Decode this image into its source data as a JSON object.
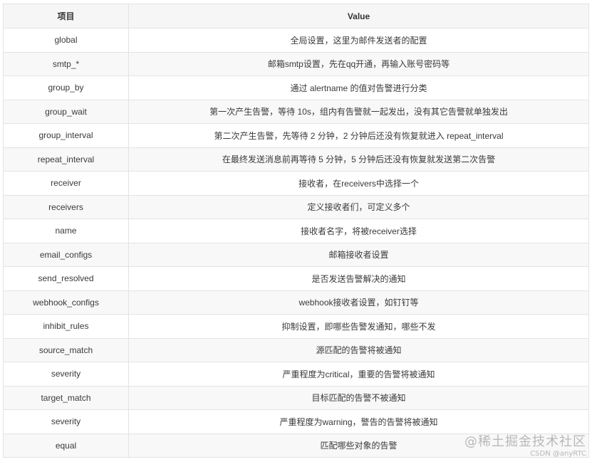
{
  "table": {
    "headers": [
      "项目",
      "Value"
    ],
    "rows": [
      {
        "key": "global",
        "value": "全局设置，这里为邮件发送者的配置"
      },
      {
        "key": "smtp_*",
        "value": "邮箱smtp设置，先在qq开通，再输入账号密码等"
      },
      {
        "key": "group_by",
        "value": "通过 alertname 的值对告警进行分类"
      },
      {
        "key": "group_wait",
        "value": "第一次产生告警，等待 10s，组内有告警就一起发出，没有其它告警就单独发出"
      },
      {
        "key": "group_interval",
        "value": "第二次产生告警，先等待 2 分钟，2 分钟后还没有恢复就进入 repeat_interval"
      },
      {
        "key": "repeat_interval",
        "value": "在最终发送消息前再等待 5 分钟，5 分钟后还没有恢复就发送第二次告警"
      },
      {
        "key": "receiver",
        "value": "接收者，在receivers中选择一个"
      },
      {
        "key": "receivers",
        "value": "定义接收者们，可定义多个"
      },
      {
        "key": "name",
        "value": "接收者名字，将被receiver选择"
      },
      {
        "key": "email_configs",
        "value": "邮箱接收者设置"
      },
      {
        "key": "send_resolved",
        "value": "是否发送告警解决的通知"
      },
      {
        "key": "webhook_configs",
        "value": "webhook接收者设置，如钉钉等"
      },
      {
        "key": "inhibit_rules",
        "value": "抑制设置，即哪些告警发通知，哪些不发"
      },
      {
        "key": "source_match",
        "value": "源匹配的告警将被通知"
      },
      {
        "key": "severity",
        "value": "严重程度为critical，重要的告警将被通知"
      },
      {
        "key": "target_match",
        "value": "目标匹配的告警不被通知"
      },
      {
        "key": "severity",
        "value": "严重程度为warning，警告的告警将被通知"
      },
      {
        "key": "equal",
        "value": "匹配哪些对象的告警"
      }
    ]
  },
  "watermark": {
    "main": "@稀土掘金技术社区",
    "sub": "CSDN @anyRTC"
  }
}
